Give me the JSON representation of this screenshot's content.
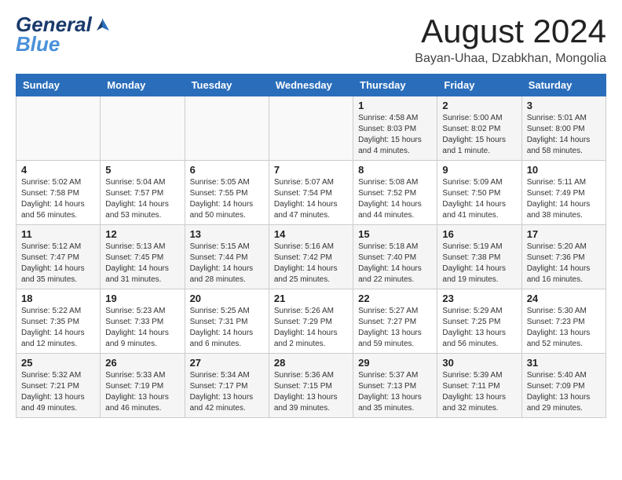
{
  "header": {
    "logo_general": "General",
    "logo_blue": "Blue",
    "month_title": "August 2024",
    "location": "Bayan-Uhaa, Dzabkhan, Mongolia"
  },
  "days_of_week": [
    "Sunday",
    "Monday",
    "Tuesday",
    "Wednesday",
    "Thursday",
    "Friday",
    "Saturday"
  ],
  "weeks": [
    [
      {
        "day": "",
        "info": ""
      },
      {
        "day": "",
        "info": ""
      },
      {
        "day": "",
        "info": ""
      },
      {
        "day": "",
        "info": ""
      },
      {
        "day": "1",
        "info": "Sunrise: 4:58 AM\nSunset: 8:03 PM\nDaylight: 15 hours\nand 4 minutes."
      },
      {
        "day": "2",
        "info": "Sunrise: 5:00 AM\nSunset: 8:02 PM\nDaylight: 15 hours\nand 1 minute."
      },
      {
        "day": "3",
        "info": "Sunrise: 5:01 AM\nSunset: 8:00 PM\nDaylight: 14 hours\nand 58 minutes."
      }
    ],
    [
      {
        "day": "4",
        "info": "Sunrise: 5:02 AM\nSunset: 7:58 PM\nDaylight: 14 hours\nand 56 minutes."
      },
      {
        "day": "5",
        "info": "Sunrise: 5:04 AM\nSunset: 7:57 PM\nDaylight: 14 hours\nand 53 minutes."
      },
      {
        "day": "6",
        "info": "Sunrise: 5:05 AM\nSunset: 7:55 PM\nDaylight: 14 hours\nand 50 minutes."
      },
      {
        "day": "7",
        "info": "Sunrise: 5:07 AM\nSunset: 7:54 PM\nDaylight: 14 hours\nand 47 minutes."
      },
      {
        "day": "8",
        "info": "Sunrise: 5:08 AM\nSunset: 7:52 PM\nDaylight: 14 hours\nand 44 minutes."
      },
      {
        "day": "9",
        "info": "Sunrise: 5:09 AM\nSunset: 7:50 PM\nDaylight: 14 hours\nand 41 minutes."
      },
      {
        "day": "10",
        "info": "Sunrise: 5:11 AM\nSunset: 7:49 PM\nDaylight: 14 hours\nand 38 minutes."
      }
    ],
    [
      {
        "day": "11",
        "info": "Sunrise: 5:12 AM\nSunset: 7:47 PM\nDaylight: 14 hours\nand 35 minutes."
      },
      {
        "day": "12",
        "info": "Sunrise: 5:13 AM\nSunset: 7:45 PM\nDaylight: 14 hours\nand 31 minutes."
      },
      {
        "day": "13",
        "info": "Sunrise: 5:15 AM\nSunset: 7:44 PM\nDaylight: 14 hours\nand 28 minutes."
      },
      {
        "day": "14",
        "info": "Sunrise: 5:16 AM\nSunset: 7:42 PM\nDaylight: 14 hours\nand 25 minutes."
      },
      {
        "day": "15",
        "info": "Sunrise: 5:18 AM\nSunset: 7:40 PM\nDaylight: 14 hours\nand 22 minutes."
      },
      {
        "day": "16",
        "info": "Sunrise: 5:19 AM\nSunset: 7:38 PM\nDaylight: 14 hours\nand 19 minutes."
      },
      {
        "day": "17",
        "info": "Sunrise: 5:20 AM\nSunset: 7:36 PM\nDaylight: 14 hours\nand 16 minutes."
      }
    ],
    [
      {
        "day": "18",
        "info": "Sunrise: 5:22 AM\nSunset: 7:35 PM\nDaylight: 14 hours\nand 12 minutes."
      },
      {
        "day": "19",
        "info": "Sunrise: 5:23 AM\nSunset: 7:33 PM\nDaylight: 14 hours\nand 9 minutes."
      },
      {
        "day": "20",
        "info": "Sunrise: 5:25 AM\nSunset: 7:31 PM\nDaylight: 14 hours\nand 6 minutes."
      },
      {
        "day": "21",
        "info": "Sunrise: 5:26 AM\nSunset: 7:29 PM\nDaylight: 14 hours\nand 2 minutes."
      },
      {
        "day": "22",
        "info": "Sunrise: 5:27 AM\nSunset: 7:27 PM\nDaylight: 13 hours\nand 59 minutes."
      },
      {
        "day": "23",
        "info": "Sunrise: 5:29 AM\nSunset: 7:25 PM\nDaylight: 13 hours\nand 56 minutes."
      },
      {
        "day": "24",
        "info": "Sunrise: 5:30 AM\nSunset: 7:23 PM\nDaylight: 13 hours\nand 52 minutes."
      }
    ],
    [
      {
        "day": "25",
        "info": "Sunrise: 5:32 AM\nSunset: 7:21 PM\nDaylight: 13 hours\nand 49 minutes."
      },
      {
        "day": "26",
        "info": "Sunrise: 5:33 AM\nSunset: 7:19 PM\nDaylight: 13 hours\nand 46 minutes."
      },
      {
        "day": "27",
        "info": "Sunrise: 5:34 AM\nSunset: 7:17 PM\nDaylight: 13 hours\nand 42 minutes."
      },
      {
        "day": "28",
        "info": "Sunrise: 5:36 AM\nSunset: 7:15 PM\nDaylight: 13 hours\nand 39 minutes."
      },
      {
        "day": "29",
        "info": "Sunrise: 5:37 AM\nSunset: 7:13 PM\nDaylight: 13 hours\nand 35 minutes."
      },
      {
        "day": "30",
        "info": "Sunrise: 5:39 AM\nSunset: 7:11 PM\nDaylight: 13 hours\nand 32 minutes."
      },
      {
        "day": "31",
        "info": "Sunrise: 5:40 AM\nSunset: 7:09 PM\nDaylight: 13 hours\nand 29 minutes."
      }
    ]
  ]
}
